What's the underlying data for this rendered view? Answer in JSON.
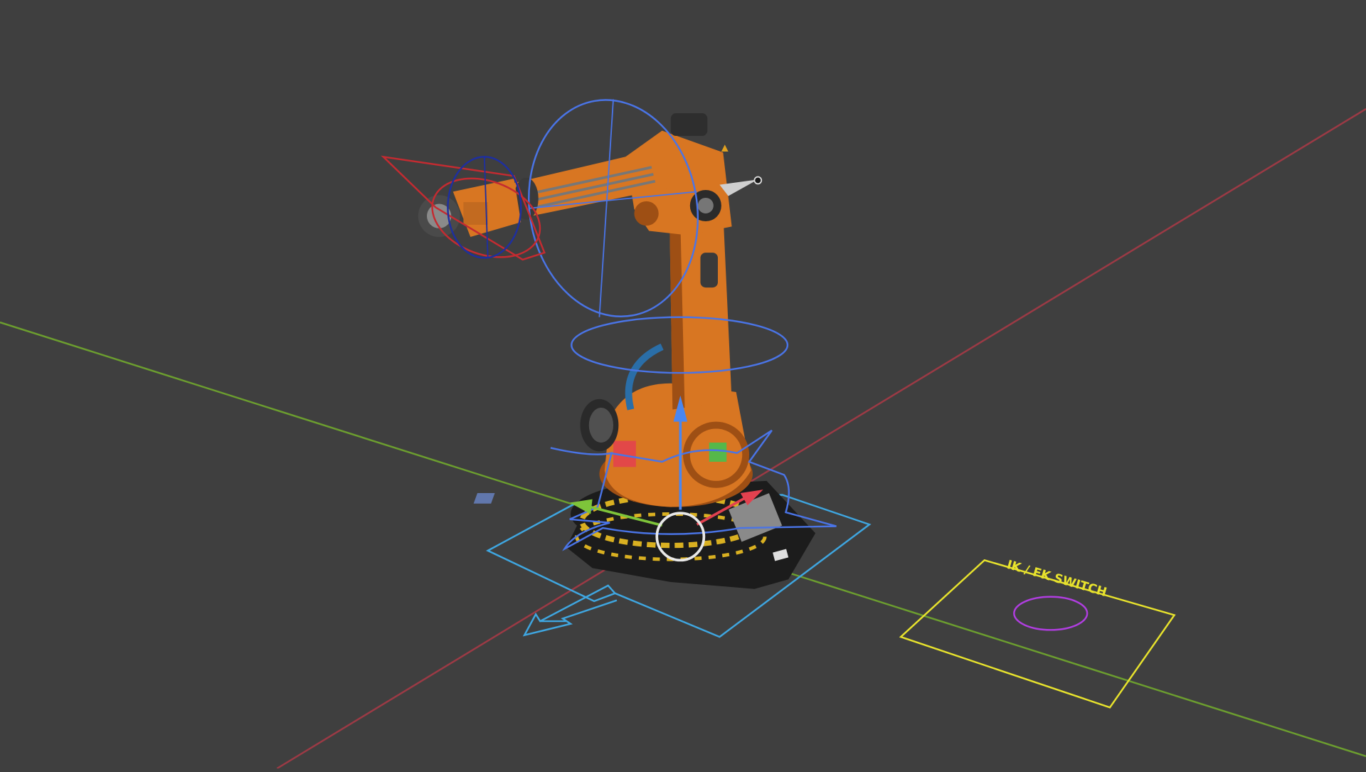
{
  "viewport": {
    "background": "#3f3f3f",
    "axis_x_color": "#9c3a45",
    "axis_y_color": "#6c9e2f"
  },
  "robot": {
    "body_color": "#d87622",
    "body_shadow": "#9e4f14",
    "body_highlight": "#f09a4a",
    "base_color": "#1c1c1c",
    "hazard_color": "#d9b021"
  },
  "rig": {
    "fk_circle_color": "#4a74e6",
    "root_control_color": "#3fa6e0",
    "ik_target_color": "#c42b31",
    "wrist_circle_color": "#1e2fa0",
    "pole_color": "#cfcfcf"
  },
  "gizmo": {
    "z_color": "#4a86f0",
    "x_color": "#e2414f",
    "y_color": "#7ec43a",
    "center_ring_color": "#e8e8e8"
  },
  "switch_control": {
    "label": "IK / FK SWITCH",
    "frame_color": "#e8e32d",
    "knob_color": "#b03ee0"
  }
}
